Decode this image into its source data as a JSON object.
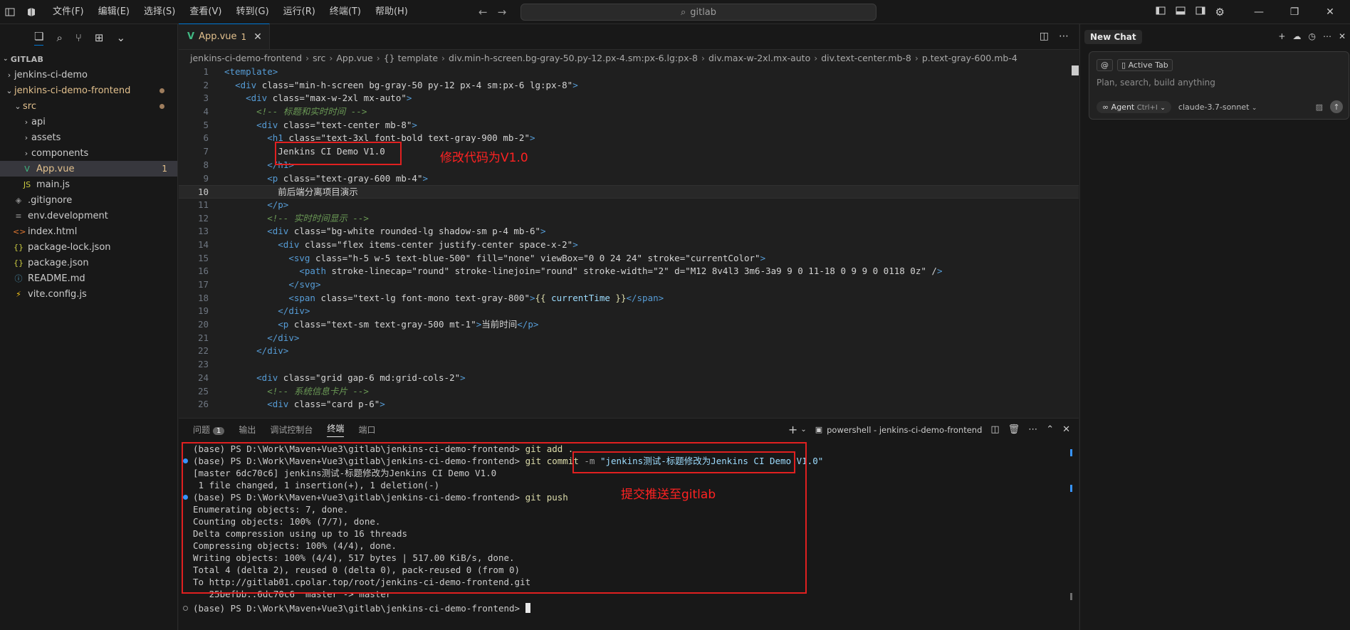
{
  "menu": [
    "文件(F)",
    "编辑(E)",
    "选择(S)",
    "查看(V)",
    "转到(G)",
    "运行(R)",
    "终端(T)",
    "帮助(H)"
  ],
  "command_center": {
    "text": "gitlab"
  },
  "window_controls": {
    "minimize": "—",
    "restore": "❐",
    "close": "✕"
  },
  "explorer": {
    "section": "GITLAB",
    "items": [
      {
        "label": "jenkins-ci-demo",
        "indent": 0,
        "type": "folder-collapsed"
      },
      {
        "label": "jenkins-ci-demo-frontend",
        "indent": 0,
        "type": "folder-open",
        "modified": true
      },
      {
        "label": "src",
        "indent": 1,
        "type": "folder-open",
        "modified": true
      },
      {
        "label": "api",
        "indent": 2,
        "type": "folder-collapsed"
      },
      {
        "label": "assets",
        "indent": 2,
        "type": "folder-collapsed"
      },
      {
        "label": "components",
        "indent": 2,
        "type": "folder-collapsed"
      },
      {
        "label": "App.vue",
        "indent": 2,
        "type": "vue",
        "count": "1",
        "selected": true
      },
      {
        "label": "main.js",
        "indent": 2,
        "type": "js"
      },
      {
        "label": ".gitignore",
        "indent": 1,
        "type": "git"
      },
      {
        "label": "env.development",
        "indent": 1,
        "type": "env"
      },
      {
        "label": "index.html",
        "indent": 1,
        "type": "html"
      },
      {
        "label": "package-lock.json",
        "indent": 1,
        "type": "json"
      },
      {
        "label": "package.json",
        "indent": 1,
        "type": "json"
      },
      {
        "label": "README.md",
        "indent": 1,
        "type": "md"
      },
      {
        "label": "vite.config.js",
        "indent": 1,
        "type": "vite"
      }
    ]
  },
  "editor": {
    "tab": {
      "label": "App.vue",
      "count": "1"
    },
    "breadcrumbs": [
      "jenkins-ci-demo-frontend",
      "src",
      "App.vue",
      "{} template",
      "div.min-h-screen.bg-gray-50.py-12.px-4.sm:px-6.lg:px-8",
      "div.max-w-2xl.mx-auto",
      "div.text-center.mb-8",
      "p.text-gray-600.mb-4"
    ],
    "current_line": 10,
    "lines": [
      "<template>",
      "  <div class=\"min-h-screen bg-gray-50 py-12 px-4 sm:px-6 lg:px-8\">",
      "    <div class=\"max-w-2xl mx-auto\">",
      "      <!-- 标题和实时时间 -->",
      "      <div class=\"text-center mb-8\">",
      "        <h1 class=\"text-3xl font-bold text-gray-900 mb-2\">",
      "          Jenkins CI Demo V1.0",
      "        </h1>",
      "        <p class=\"text-gray-600 mb-4\">",
      "          前后端分离项目演示",
      "        </p>",
      "        <!-- 实时时间显示 -->",
      "        <div class=\"bg-white rounded-lg shadow-sm p-4 mb-6\">",
      "          <div class=\"flex items-center justify-center space-x-2\">",
      "            <svg class=\"h-5 w-5 text-blue-500\" fill=\"none\" viewBox=\"0 0 24 24\" stroke=\"currentColor\">",
      "              <path stroke-linecap=\"round\" stroke-linejoin=\"round\" stroke-width=\"2\" d=\"M12 8v4l3 3m6-3a9 9 0 11-18 0 9 9 0 0118 0z\" />",
      "            </svg>",
      "            <span class=\"text-lg font-mono text-gray-800\">{{ currentTime }}</span>",
      "          </div>",
      "          <p class=\"text-sm text-gray-500 mt-1\">当前时间</p>",
      "        </div>",
      "      </div>",
      "",
      "      <div class=\"grid gap-6 md:grid-cols-2\">",
      "        <!-- 系统信息卡片 -->",
      "        <div class=\"card p-6\">"
    ],
    "annotation": "修改代码为V1.0"
  },
  "panel": {
    "tabs": [
      "问题",
      "输出",
      "调试控制台",
      "终端",
      "端口"
    ],
    "problems_count": "1",
    "active_tab": "终端",
    "terminal_name": "powershell - jenkins-ci-demo-frontend",
    "annotation": "提交推送至gitlab",
    "prompt": "(base) PS D:\\Work\\Maven+Vue3\\gitlab\\jenkins-ci-demo-frontend>",
    "lines": [
      {
        "mark": "none",
        "kind": "cmd",
        "text": "git add ."
      },
      {
        "mark": "blue",
        "kind": "commit",
        "text": "git commit",
        "flag": "-m",
        "msg": "\"jenkins测试-标题修改为Jenkins CI Demo V1.0\""
      },
      {
        "mark": "none",
        "kind": "out",
        "text": "[master 6dc70c6] jenkins测试-标题修改为Jenkins CI Demo V1.0"
      },
      {
        "mark": "none",
        "kind": "out",
        "text": " 1 file changed, 1 insertion(+), 1 deletion(-)"
      },
      {
        "mark": "blue",
        "kind": "cmd",
        "text": "git push"
      },
      {
        "mark": "none",
        "kind": "out",
        "text": "Enumerating objects: 7, done."
      },
      {
        "mark": "none",
        "kind": "out",
        "text": "Counting objects: 100% (7/7), done."
      },
      {
        "mark": "none",
        "kind": "out",
        "text": "Delta compression using up to 16 threads"
      },
      {
        "mark": "none",
        "kind": "out",
        "text": "Compressing objects: 100% (4/4), done."
      },
      {
        "mark": "none",
        "kind": "out",
        "text": "Writing objects: 100% (4/4), 517 bytes | 517.00 KiB/s, done."
      },
      {
        "mark": "none",
        "kind": "out",
        "text": "Total 4 (delta 2), reused 0 (delta 0), pack-reused 0 (from 0)"
      },
      {
        "mark": "none",
        "kind": "out",
        "text": "To http://gitlab01.cpolar.top/root/jenkins-ci-demo-frontend.git"
      },
      {
        "mark": "none",
        "kind": "out",
        "text": "   25befbb..6dc70c6  master -> master"
      },
      {
        "mark": "grey",
        "kind": "prompt-only",
        "text": ""
      }
    ]
  },
  "chat": {
    "tab": "New Chat",
    "chip_at": "@",
    "chip_active": "Active Tab",
    "placeholder": "Plan, search, build anything",
    "agent_label": "Agent",
    "agent_shortcut": "Ctrl+I",
    "model": "claude-3.7-sonnet"
  },
  "colors": {
    "accent": "#0078d4",
    "annotation": "#e02020",
    "modified": "#e2c08d"
  }
}
